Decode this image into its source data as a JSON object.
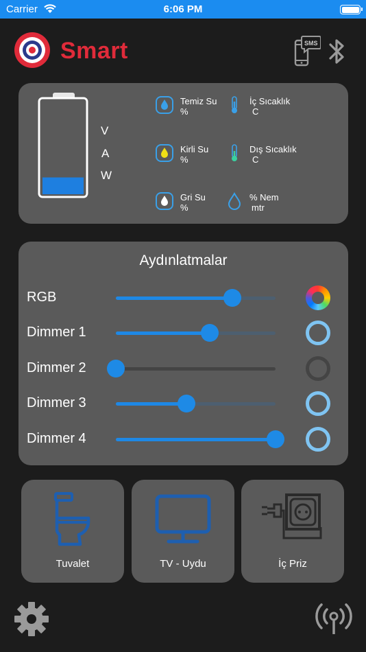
{
  "status_bar": {
    "carrier": "Carrier",
    "time": "6:06 PM"
  },
  "header": {
    "brand": "Smart",
    "sms_badge": "SMS",
    "icons": [
      "target-logo-icon",
      "phone-sms-icon",
      "bluetooth-icon"
    ]
  },
  "power": {
    "level_percent": 18,
    "labels": [
      "V",
      "A",
      "W"
    ]
  },
  "sensors": [
    {
      "name": "Temiz Su",
      "unit": "%",
      "icon": "water-drop-icon",
      "color": "#3aa0e8"
    },
    {
      "name": "İç Sıcaklık",
      "unit": "C",
      "icon": "thermometer-icon",
      "color": "#3aa0e8"
    },
    {
      "name": "Kirli Su",
      "unit": "%",
      "icon": "water-drop-icon",
      "color": "#f0e016"
    },
    {
      "name": "Dış Sıcaklık",
      "unit": "C",
      "icon": "thermometer-icon",
      "color": "#3ad0a0"
    },
    {
      "name": "Gri Su",
      "unit": "%",
      "icon": "water-drop-icon",
      "color": "#ffffff"
    },
    {
      "name": "% Nem",
      "unit": "mtr",
      "icon": "humidity-drop-icon",
      "color": "#3aa0e8"
    }
  ],
  "lights": {
    "title": "Aydınlatmalar",
    "items": [
      {
        "label": "RGB",
        "value": 73,
        "state": "rgb"
      },
      {
        "label": "Dimmer 1",
        "value": 59,
        "state": "on"
      },
      {
        "label": "Dimmer 2",
        "value": 0,
        "state": "off"
      },
      {
        "label": "Dimmer 3",
        "value": 44,
        "state": "on"
      },
      {
        "label": "Dimmer 4",
        "value": 100,
        "state": "on"
      }
    ]
  },
  "tiles": [
    {
      "label": "Tuvalet",
      "icon": "toilet-icon"
    },
    {
      "label": "TV - Uydu",
      "icon": "tv-icon"
    },
    {
      "label": "İç Priz",
      "icon": "power-socket-icon"
    }
  ],
  "footer": {
    "icons": [
      "settings-gear-icon",
      "broadcast-antenna-icon"
    ]
  },
  "colors": {
    "accent": "#1e88e5",
    "brand_red": "#e02b3a",
    "card": "#5a5a5a",
    "background": "#1c1c1c",
    "ring_on": "#7fc4f2"
  }
}
